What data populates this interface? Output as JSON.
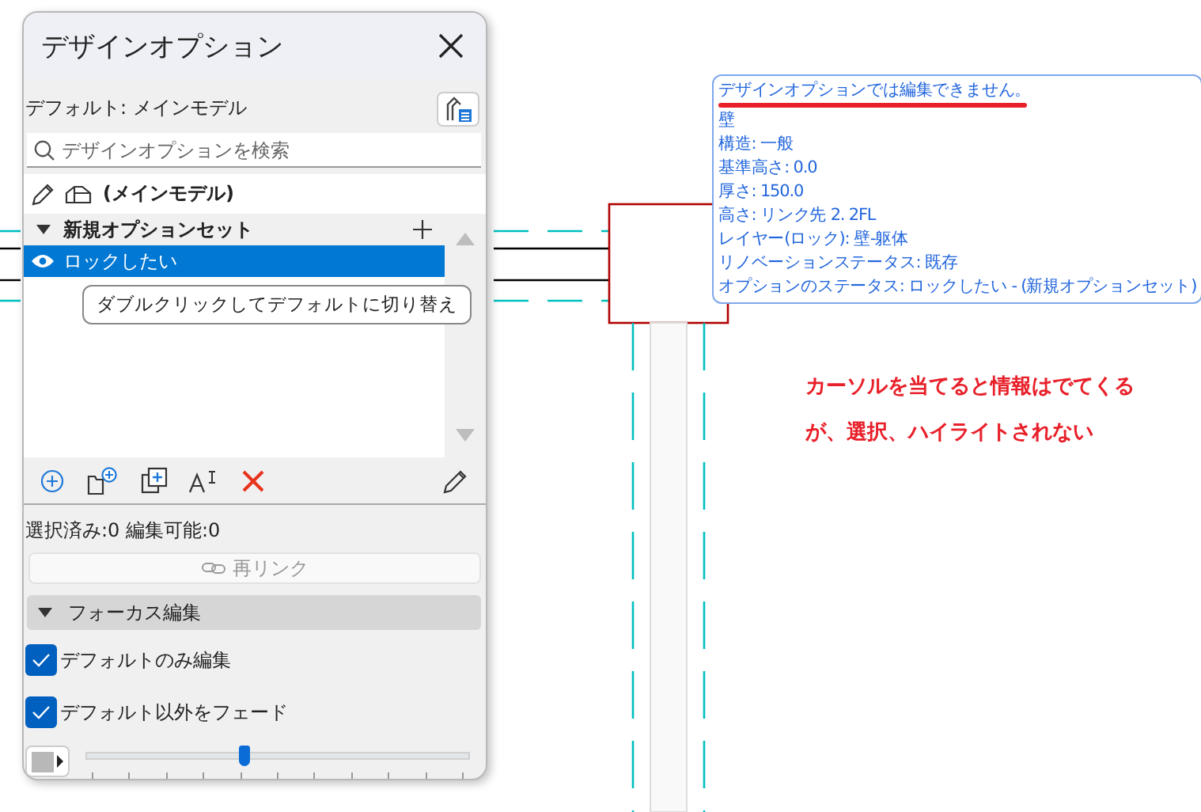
{
  "window": {
    "title": "デザインオプション"
  },
  "default_label": "デフォルト: メインモデル",
  "search": {
    "placeholder": "デザインオプションを検索"
  },
  "main_model": "(メインモデル)",
  "option_sets": [
    {
      "name": "新規オプションセット",
      "expanded": true,
      "options": [
        {
          "name": "ロックしたい",
          "selected": true,
          "visible": true
        }
      ]
    }
  ],
  "hint": "ダブルクリックしてデフォルトに切り替え",
  "status": "選択済み:0 編集可能:0",
  "relink_button": {
    "label": "再リンク",
    "disabled": true
  },
  "focus_section": {
    "title": "フォーカス編集",
    "expanded": true,
    "checkboxes": [
      {
        "label": "デフォルトのみ編集",
        "checked": true
      },
      {
        "label": "デフォルト以外をフェード",
        "checked": true
      }
    ]
  },
  "fade_slider": {
    "level": 0.41
  },
  "info_popup": {
    "lines": [
      "デザインオプションでは編集できません。",
      "壁",
      "構造: 一般",
      "基準高さ: 0.0",
      "厚さ: 150.0",
      "高さ: リンク先 2. 2FL",
      "レイヤー(ロック): 壁-躯体",
      "リノベーションステータス: 既存",
      "オプションのステータス: ロックしたい - (新規オプションセット)"
    ]
  },
  "annotation": {
    "lines": [
      "カーソルを当てると情報はでてくる",
      "が、選択、ハイライトされない"
    ]
  }
}
